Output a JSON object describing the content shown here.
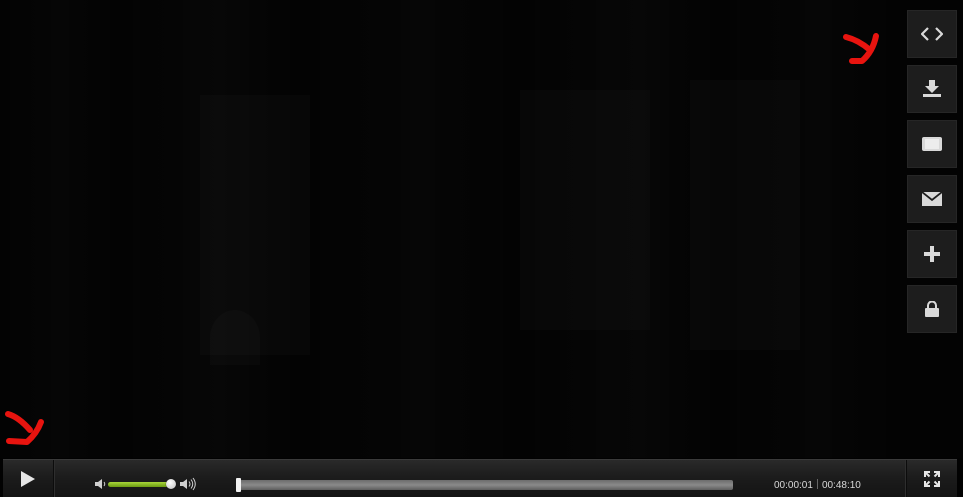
{
  "player": {
    "side_buttons": [
      {
        "name": "embed-button",
        "icon": "code-brackets-icon"
      },
      {
        "name": "download-button",
        "icon": "download-icon"
      },
      {
        "name": "theater-button",
        "icon": "widescreen-icon"
      },
      {
        "name": "email-button",
        "icon": "envelope-icon"
      },
      {
        "name": "add-button",
        "icon": "plus-icon"
      },
      {
        "name": "lock-button",
        "icon": "lock-icon"
      }
    ],
    "controls": {
      "play_icon": "play-icon",
      "volume_level": 0.98,
      "seek_progress": 0.0003,
      "current_time": "00:00:01",
      "duration": "00:48:10",
      "fullscreen_icon": "fullscreen-icon"
    },
    "colors": {
      "annotation_red": "#e8140f",
      "volume_green": "#8cbc22",
      "button_bg": "#1d1d1d"
    }
  }
}
